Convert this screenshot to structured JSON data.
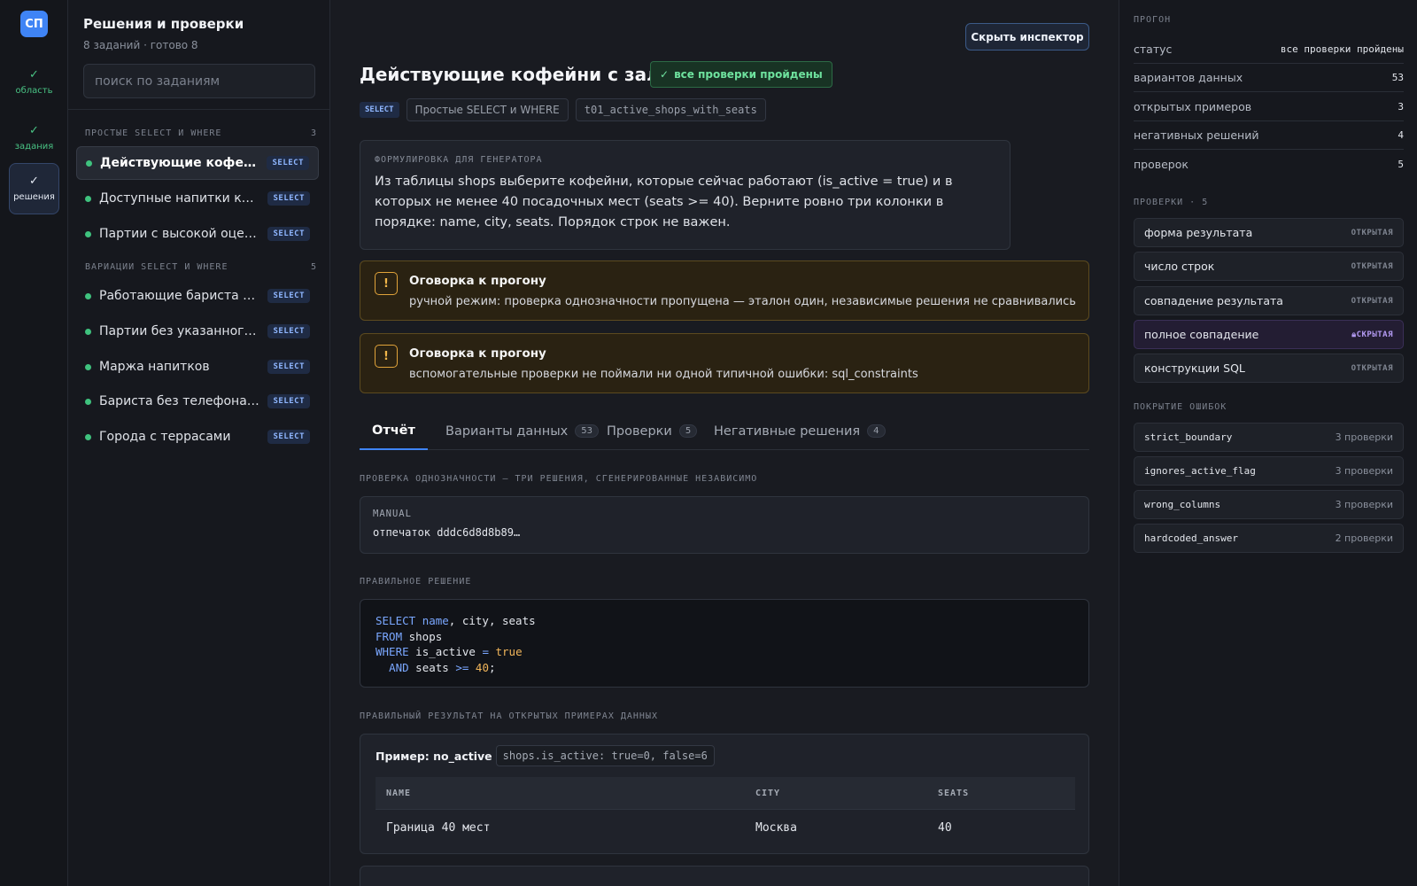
{
  "rail": {
    "logo": "СП",
    "items": [
      {
        "label": "область",
        "state": "done"
      },
      {
        "label": "задания",
        "state": "done"
      },
      {
        "label": "решения",
        "state": "active"
      }
    ]
  },
  "sidebar": {
    "title": "Решения и проверки",
    "subtitle": "8 заданий · готово 8",
    "search_placeholder": "поиск по заданиям",
    "groups": [
      {
        "label": "ПРОСТЫЕ SELECT И WHERE",
        "count": "3"
      },
      {
        "label": "ВАРИАЦИИ SELECT И WHERE",
        "count": "5"
      }
    ],
    "tasks": [
      {
        "name": "Действующие кофейни с залом",
        "badge": "SELECT"
      },
      {
        "name": "Доступные напитки категории",
        "badge": "SELECT"
      },
      {
        "name": "Партии с высокой оценкой",
        "badge": "SELECT"
      },
      {
        "name": "Работающие бариста от стажа",
        "badge": "SELECT"
      },
      {
        "name": "Партии без указанного региона",
        "badge": "SELECT"
      },
      {
        "name": "Маржа напитков",
        "badge": "SELECT"
      },
      {
        "name": "Бариста без телефона, но с почтой",
        "badge": "SELECT"
      },
      {
        "name": "Города с террасами",
        "badge": "SELECT"
      }
    ]
  },
  "main": {
    "hide_inspector": "Скрыть инспектор",
    "title": "Действующие кофейни с залом",
    "status_pill": "все проверки пройдены",
    "chips": {
      "kind": "SELECT",
      "group": "Простые SELECT и WHERE",
      "id": "t01_active_shops_with_seats"
    },
    "generator": {
      "caption": "ФОРМУЛИРОВКА ДЛЯ ГЕНЕРАТОРА",
      "text": "Из таблицы shops выберите кофейни, которые сейчас работают (is_active = true) и в которых не менее 40 посадочных мест (seats >= 40). Верните ровно три колонки в порядке: name, city, seats. Порядок строк не важен."
    },
    "warnings": [
      {
        "icon": "!",
        "title": "Оговорка к прогону",
        "body": "ручной режим: проверка однозначности пропущена — эталон один, независимые решения не сравнивались"
      },
      {
        "icon": "!",
        "title": "Оговорка к прогону",
        "body": "вспомогательные проверки не поймали ни одной типичной ошибки: sql_constraints"
      }
    ],
    "tabs": [
      {
        "label": "Отчёт",
        "count": ""
      },
      {
        "label": "Варианты данных",
        "count": "53"
      },
      {
        "label": "Проверки",
        "count": "5"
      },
      {
        "label": "Негативные решения",
        "count": "4"
      }
    ],
    "uniqueness": {
      "caption": "ПРОВЕРКА ОДНОЗНАЧНОСТИ — ТРИ РЕШЕНИЯ, СГЕНЕРИРОВАННЫЕ НЕЗАВИСИМО",
      "mode": "MANUAL",
      "fingerprint": "отпечаток dddc6d8d8b89…"
    },
    "solution": {
      "caption": "ПРАВИЛЬНОЕ РЕШЕНИЕ"
    },
    "results": {
      "caption": "ПРАВИЛЬНЫЙ РЕЗУЛЬТАТ НА ОТКРЫТЫХ ПРИМЕРАХ ДАННЫХ",
      "example_label": "Пример: no_active",
      "example_code": "shops.is_active: true=0, false=6",
      "columns": [
        "NAME",
        "CITY",
        "SEATS"
      ],
      "rows": [
        [
          "Граница 40 мест",
          "Москва",
          "40"
        ]
      ]
    }
  },
  "inspector": {
    "run_caption": "ПРОГОН",
    "stats": [
      {
        "label": "статус",
        "value": "все проверки пройдены"
      },
      {
        "label": "вариантов данных",
        "value": "53"
      },
      {
        "label": "открытых примеров",
        "value": "3"
      },
      {
        "label": "негативных решений",
        "value": "4"
      },
      {
        "label": "проверок",
        "value": "5"
      }
    ],
    "checks_caption": "ПРОВЕРКИ · 5",
    "checks": [
      {
        "name": "форма результата",
        "tag": "ОТКРЫТАЯ"
      },
      {
        "name": "число строк",
        "tag": "ОТКРЫТАЯ"
      },
      {
        "name": "совпадение результата",
        "tag": "ОТКРЫТАЯ"
      },
      {
        "name": "полное совпадение",
        "tag": "СКРЫТАЯ"
      },
      {
        "name": "конструкции SQL",
        "tag": "ОТКРЫТАЯ"
      }
    ],
    "coverage_caption": "ПОКРЫТИЕ ОШИБОК",
    "coverage": [
      {
        "name": "strict_boundary",
        "count": "3 проверки"
      },
      {
        "name": "ignores_active_flag",
        "count": "3 проверки"
      },
      {
        "name": "wrong_columns",
        "count": "3 проверки"
      },
      {
        "name": "hardcoded_answer",
        "count": "2 проверки"
      }
    ]
  },
  "colors": {
    "accent": "#3f84f5",
    "success": "#3fc27e",
    "warning": "#e0a33a",
    "hidden": "#b39af2"
  }
}
